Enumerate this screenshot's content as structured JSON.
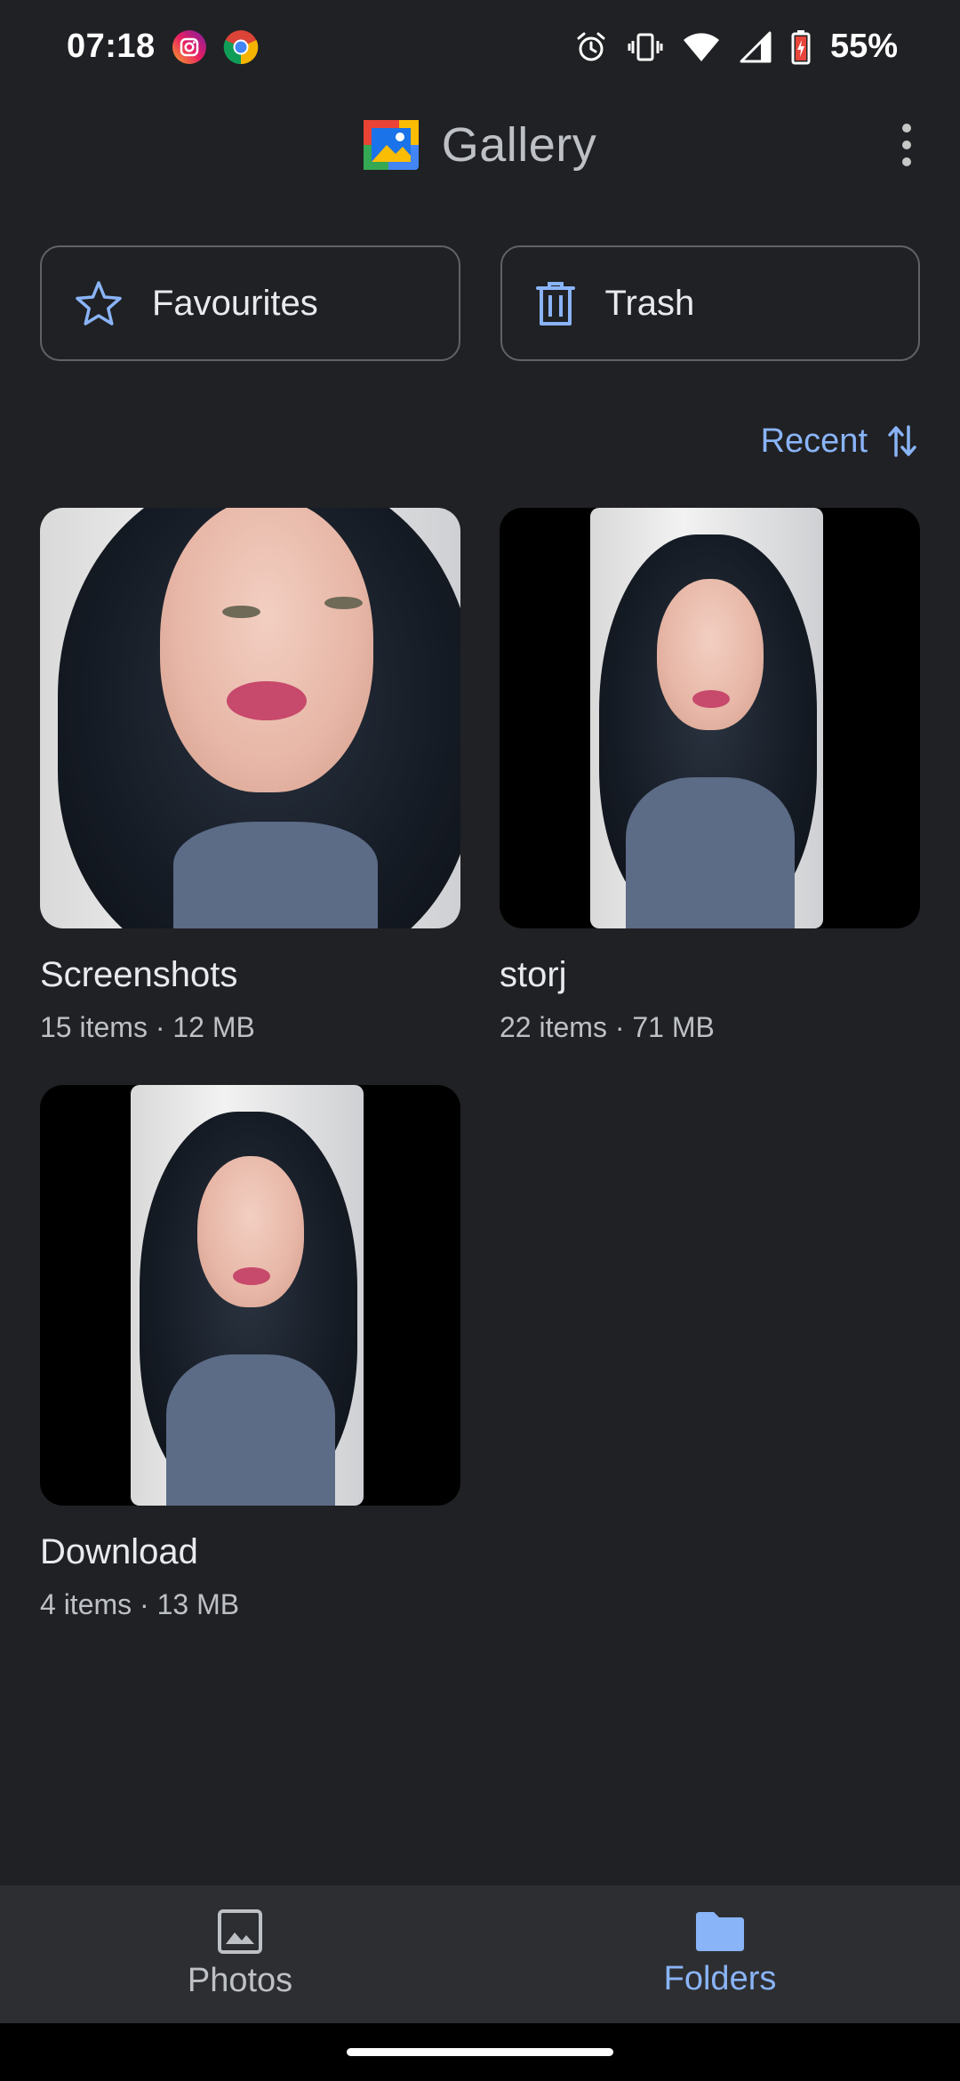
{
  "status_bar": {
    "time": "07:18",
    "battery_percent": "55%",
    "icons": [
      "instagram-icon",
      "chrome-icon",
      "alarm-icon",
      "vibrate-icon",
      "wifi-icon",
      "signal-icon",
      "battery-icon"
    ]
  },
  "app_bar": {
    "title": "Gallery",
    "logo_icon": "gallery-logo-icon",
    "overflow_icon": "more-vert-icon"
  },
  "quick_actions": {
    "favourites_label": "Favourites",
    "trash_label": "Trash"
  },
  "sort": {
    "label": "Recent"
  },
  "folders": [
    {
      "name": "Screenshots",
      "meta": "15 items · 12 MB"
    },
    {
      "name": "storj",
      "meta": "22 items · 71 MB"
    },
    {
      "name": "Download",
      "meta": "4 items · 13 MB"
    }
  ],
  "bottom_nav": {
    "photos_label": "Photos",
    "folders_label": "Folders",
    "active": "Folders"
  },
  "colors": {
    "background": "#202124",
    "accent": "#8ab4f8",
    "nav_background": "#2d2e31"
  }
}
